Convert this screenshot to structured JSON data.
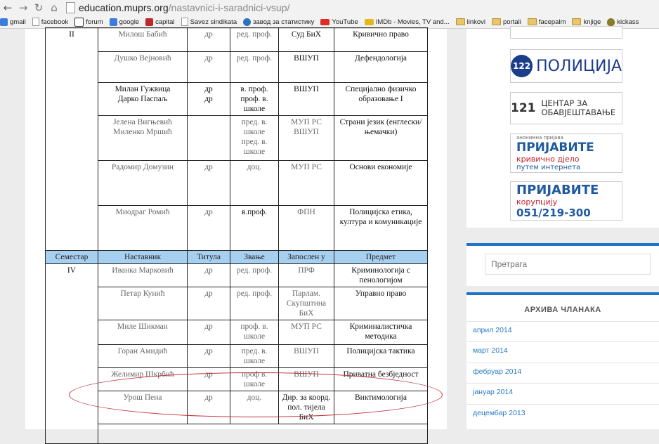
{
  "browser": {
    "url_domain": "education.muprs.org",
    "url_path": "/nastavnici-i-saradnici-vsup/",
    "bookmarks": [
      "gmail",
      "facebook",
      "forum",
      "google",
      "capital",
      "Savez sindikata",
      "завод за статистику",
      "YouTube",
      "IMDb - Movies, TV and...",
      "linkovi",
      "portali",
      "facepalm",
      "knjige",
      "kickass"
    ]
  },
  "table": {
    "header": [
      "Семестар",
      "Наставник",
      "Титула",
      "Звање",
      "Запослен у",
      "Предмет"
    ],
    "top_rows": [
      {
        "semester": "II",
        "teacher": "Милош Бабић",
        "title": "др",
        "rank": "ред. проф.",
        "employer": "Суд БиХ",
        "subject": "Кривично право"
      },
      {
        "teacher": "Душко Вејновић",
        "title": "др",
        "rank": "ред. проф.",
        "employer": "ВШУП",
        "subject": "Дефендологија"
      },
      {
        "teacher": "Милан Гужвица\nДарко Паспаљ",
        "title": "др\nдр",
        "rank": "в. проф.\nпроф. в. школе",
        "employer": "ВШУП",
        "subject": "Специјално физичко образовање I"
      },
      {
        "teacher": "Јелена Вигњевић\nМиленко Мршић",
        "title": "",
        "rank": "пред. в. школе\nпред. в. школе",
        "employer": "МУП РС\nВШУП",
        "subject": "Страни језик (енглески/њемачки)"
      },
      {
        "teacher": "Радомир Домузин",
        "title": "др",
        "rank": "доц.",
        "employer": "МУП РС",
        "subject": "Основи економије"
      },
      {
        "teacher": "Миодраг Ромић",
        "title": "др",
        "rank": "в.проф.",
        "employer": "ФПН",
        "subject": "Полицијска етика, култура и комуникације"
      }
    ],
    "bottom_rows": [
      {
        "semester": "IV",
        "teacher": "Иванка Марковић",
        "title": "др",
        "rank": "ред. проф.",
        "employer": "ПРФ",
        "subject": "Криминологија с пенологијом"
      },
      {
        "teacher": "Петар Кунић",
        "title": "др",
        "rank": "ред. проф.",
        "employer": "Парлам. Скупштина БиХ",
        "subject": "Управно право"
      },
      {
        "teacher": "Миле Шикман",
        "title": "др",
        "rank": "проф. в. школе",
        "employer": "МУП РС",
        "subject": "Криминалистичка методика"
      },
      {
        "teacher": "Горан Амидић",
        "title": "др",
        "rank": "пред. в. школе",
        "employer": "ВШУП",
        "subject": "Полицијска тактика"
      },
      {
        "teacher": "Желимир Шкрбић",
        "title": "др",
        "rank": "проф в. школе",
        "employer": "ВШУП",
        "subject": "Приватна безбједност"
      },
      {
        "teacher": "Урош Пена",
        "title": "др",
        "rank": "доц.",
        "employer": "Дир. за коорд. пол. тијела БиХ",
        "subject": "Виктимологија"
      }
    ]
  },
  "sidebar": {
    "banner_police": {
      "number": "122",
      "text": "ПОЛИЦИЈА"
    },
    "banner_info": {
      "number": "121",
      "text": "ЦЕНТАР ЗА ОБАВЈЕШТАВАЊЕ"
    },
    "banner_crime": {
      "small": "анонимна пријава",
      "main": "ПРИЈАВИТЕ",
      "red": "кривично дјело",
      "sub": "путем интернета"
    },
    "banner_corruption": {
      "main": "ПРИЈАВИТЕ",
      "red": "корупцију",
      "phone": "051/219-300"
    },
    "search_placeholder": "Претрага",
    "archive_title": "АРХИВА ЧЛАНАКА",
    "archive_items": [
      "април 2014",
      "март 2014",
      "фебруар 2014",
      "јануар 2014",
      "децембар 2013"
    ]
  },
  "colors": {
    "header_blue": "#a7cff0",
    "accent": "#1f73c9",
    "ellipse": "#c0333a"
  }
}
